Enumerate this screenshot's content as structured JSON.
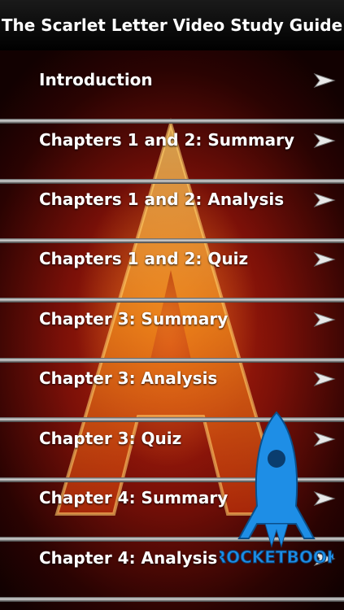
{
  "header": {
    "title": "The Scarlet Letter Video Study Guide"
  },
  "menu": [
    {
      "label": "Introduction"
    },
    {
      "label": "Chapters 1 and 2: Summary"
    },
    {
      "label": "Chapters 1 and 2: Analysis"
    },
    {
      "label": "Chapters 1 and 2: Quiz"
    },
    {
      "label": "Chapter 3: Summary"
    },
    {
      "label": "Chapter 3: Analysis"
    },
    {
      "label": "Chapter 3: Quiz"
    },
    {
      "label": "Chapter 4: Summary"
    },
    {
      "label": "Chapter 4: Analysis"
    }
  ],
  "icons": {
    "row_arrow": "chevron-right-arrow-icon"
  },
  "brand": {
    "logo_text": "ROCKETBOOK"
  },
  "colors": {
    "logo_blue": "#1e8ee6",
    "flame_orange": "#f08a1a",
    "background_red": "#7a1008"
  }
}
